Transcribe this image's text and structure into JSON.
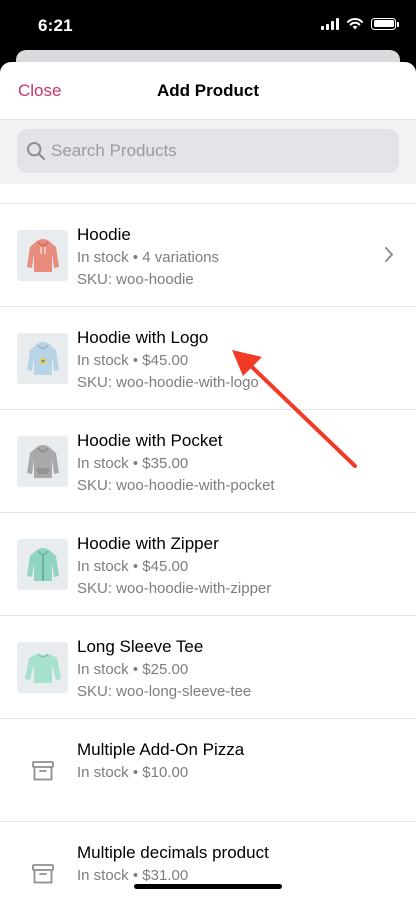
{
  "status_bar": {
    "time": "6:21"
  },
  "nav": {
    "close_label": "Close",
    "title": "Add Product"
  },
  "search": {
    "placeholder": "Search Products",
    "value": ""
  },
  "products": [
    {
      "name": "Hoodie",
      "stock": "In stock",
      "detail": "4 variations",
      "sku": "SKU: woo-hoodie",
      "thumbnail": "pink-hoodie",
      "has_chevron": true
    },
    {
      "name": "Hoodie with Logo",
      "stock": "In stock",
      "detail": "$45.00",
      "sku": "SKU: woo-hoodie-with-logo",
      "thumbnail": "blue-logo-hoodie",
      "has_chevron": false
    },
    {
      "name": "Hoodie with Pocket",
      "stock": "In stock",
      "detail": "$35.00",
      "sku": "SKU: woo-hoodie-with-pocket",
      "thumbnail": "gray-hoodie",
      "has_chevron": false
    },
    {
      "name": "Hoodie with Zipper",
      "stock": "In stock",
      "detail": "$45.00",
      "sku": "SKU: woo-hoodie-with-zipper",
      "thumbnail": "mint-zip-hoodie",
      "has_chevron": false
    },
    {
      "name": "Long Sleeve Tee",
      "stock": "In stock",
      "detail": "$25.00",
      "sku": "SKU: woo-long-sleeve-tee",
      "thumbnail": "mint-long-sleeve-tee",
      "has_chevron": false
    },
    {
      "name": "Multiple Add-On Pizza",
      "stock": "In stock",
      "detail": "$10.00",
      "sku": "",
      "thumbnail": "archive-box-icon",
      "has_chevron": false
    },
    {
      "name": "Multiple decimals product",
      "stock": "In stock",
      "detail": "$31.00",
      "sku": "",
      "thumbnail": "archive-box-icon",
      "has_chevron": false
    }
  ],
  "separator": "•",
  "colors": {
    "accent": "#c9356e",
    "annotation_arrow": "#f23a26",
    "secondary_text": "#7d7d82"
  }
}
